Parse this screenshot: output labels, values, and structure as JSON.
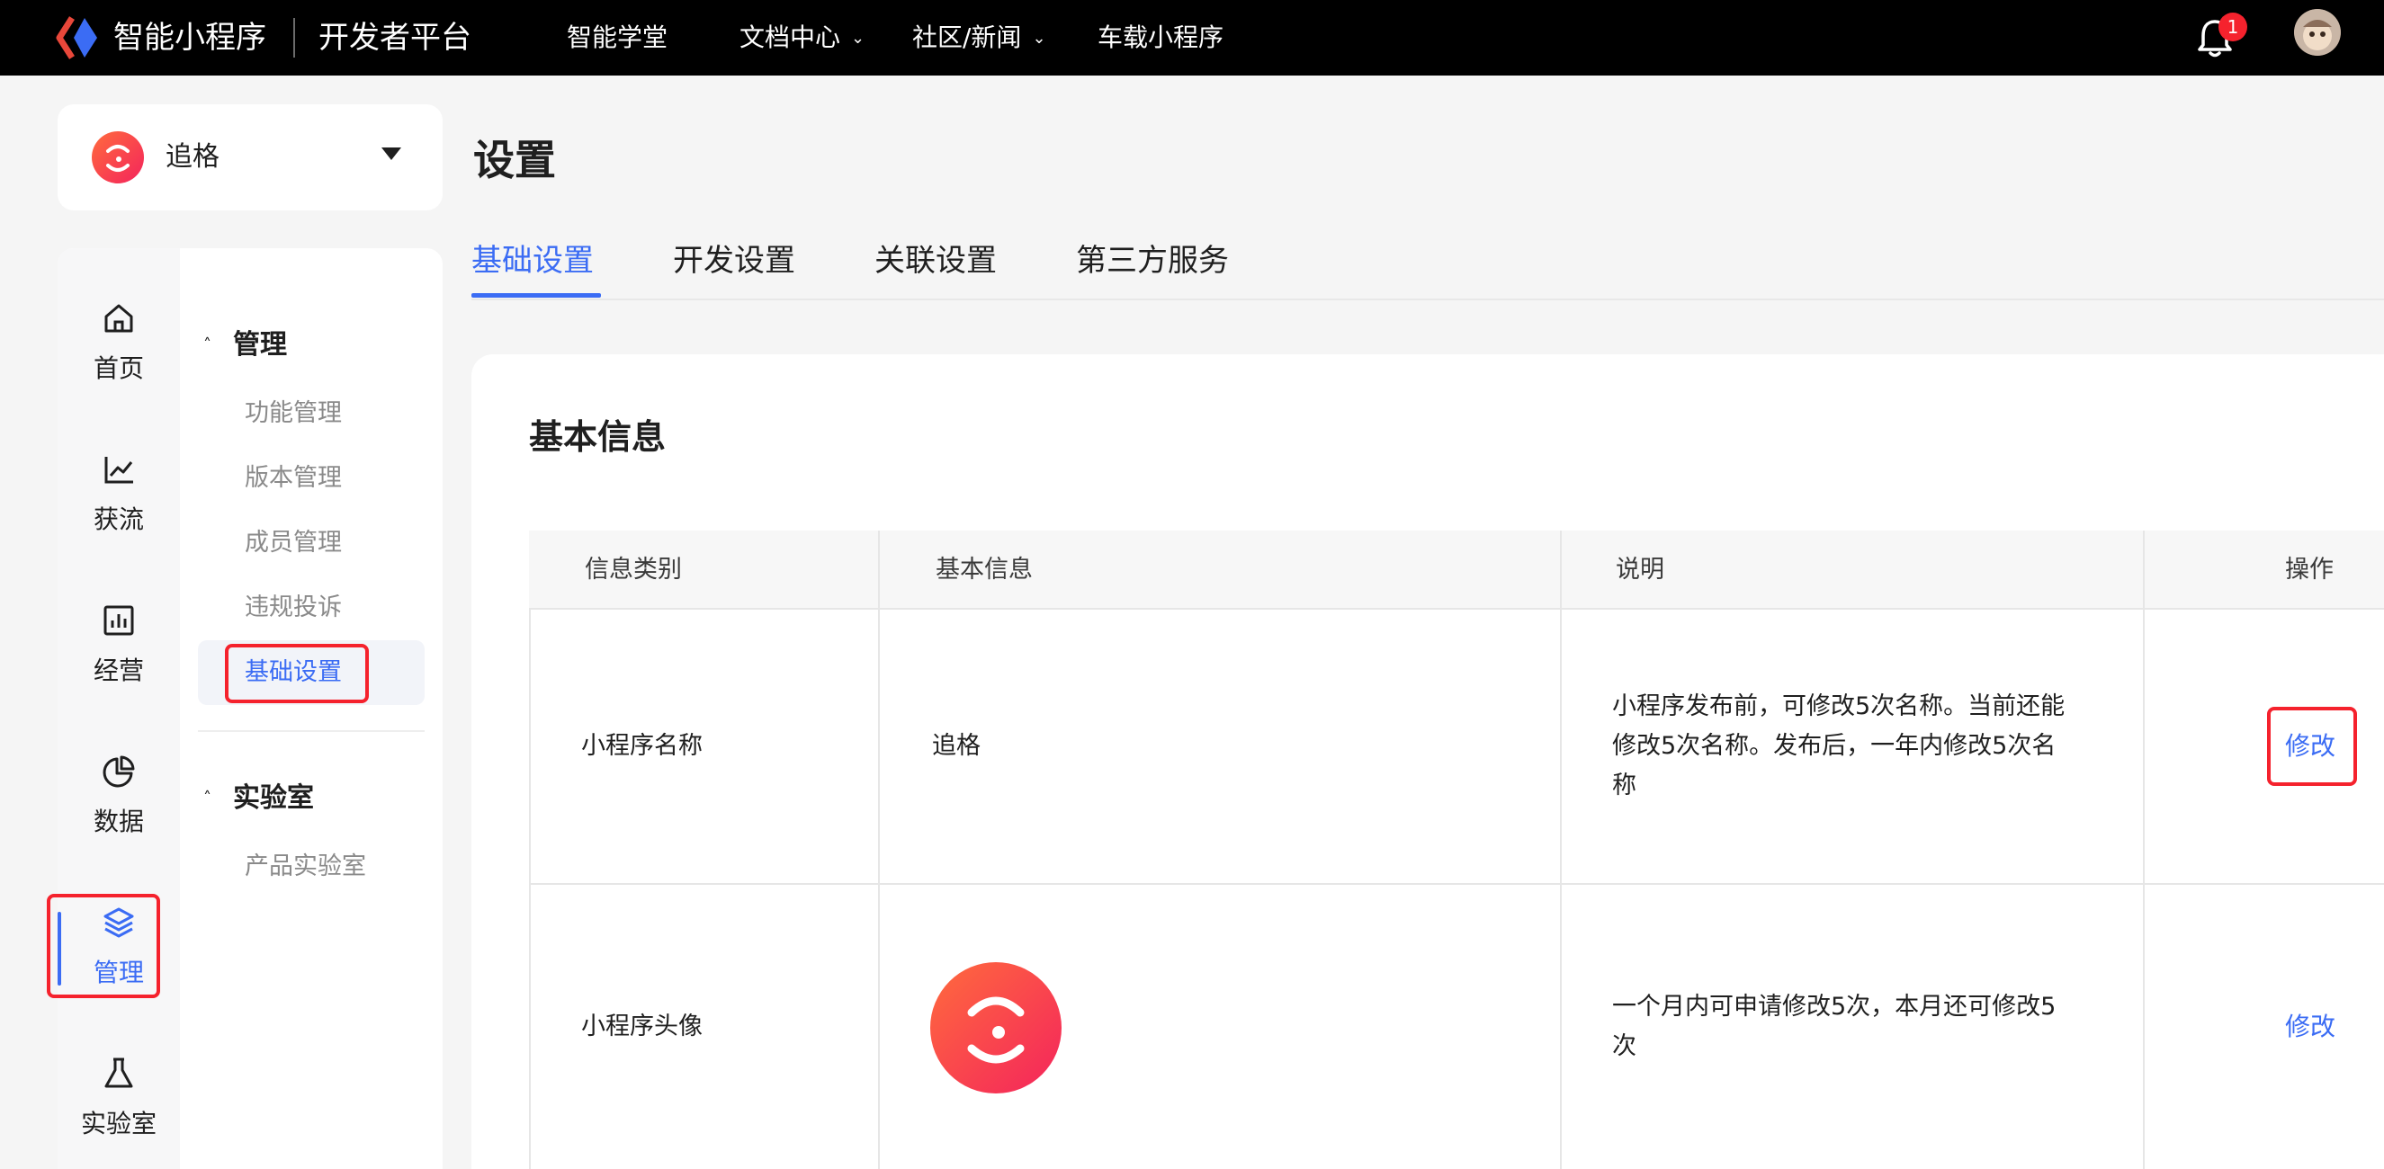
{
  "topbar": {
    "brand": "智能小程序",
    "platform": "开发者平台",
    "nav": [
      {
        "label": "智能学堂",
        "has_dropdown": false
      },
      {
        "label": "文档中心",
        "has_dropdown": true
      },
      {
        "label": "社区/新闻",
        "has_dropdown": true
      },
      {
        "label": "车载小程序",
        "has_dropdown": false
      }
    ],
    "notification_count": "1"
  },
  "app_selector": {
    "name": "追格"
  },
  "rail": {
    "items": [
      {
        "label": "首页",
        "icon": "home-icon"
      },
      {
        "label": "获流",
        "icon": "line-chart-icon"
      },
      {
        "label": "经营",
        "icon": "bar-chart-icon"
      },
      {
        "label": "数据",
        "icon": "pie-chart-icon"
      },
      {
        "label": "管理",
        "icon": "layers-icon",
        "active": true
      },
      {
        "label": "实验室",
        "icon": "flask-icon"
      }
    ]
  },
  "submenu": {
    "groups": [
      {
        "title": "管理",
        "items": [
          "功能管理",
          "版本管理",
          "成员管理",
          "违规投诉",
          "基础设置"
        ],
        "active_item": "基础设置"
      },
      {
        "title": "实验室",
        "items": [
          "产品实验室"
        ]
      }
    ]
  },
  "page": {
    "title": "设置",
    "tabs": [
      "基础设置",
      "开发设置",
      "关联设置",
      "第三方服务"
    ],
    "active_tab": "基础设置"
  },
  "basic_info": {
    "section_title": "基本信息",
    "columns": [
      "信息类别",
      "基本信息",
      "说明",
      "操作"
    ],
    "rows": [
      {
        "category": "小程序名称",
        "value": "追格",
        "note_lines": [
          "小程序发布前，可修改5次名称。当前还能",
          "修改5次名称。发布后，一年内修改5次名",
          "称"
        ],
        "action": "修改"
      },
      {
        "category": "小程序头像",
        "value": "",
        "note_lines": [
          "一个月内可申请修改5次，本月还可修改5",
          "次"
        ],
        "action": "修改"
      }
    ]
  },
  "colors": {
    "accent": "#3b6cf4",
    "highlight": "#f5222d",
    "brand_gradient": [
      "#ff6b3d",
      "#f4245c"
    ]
  }
}
